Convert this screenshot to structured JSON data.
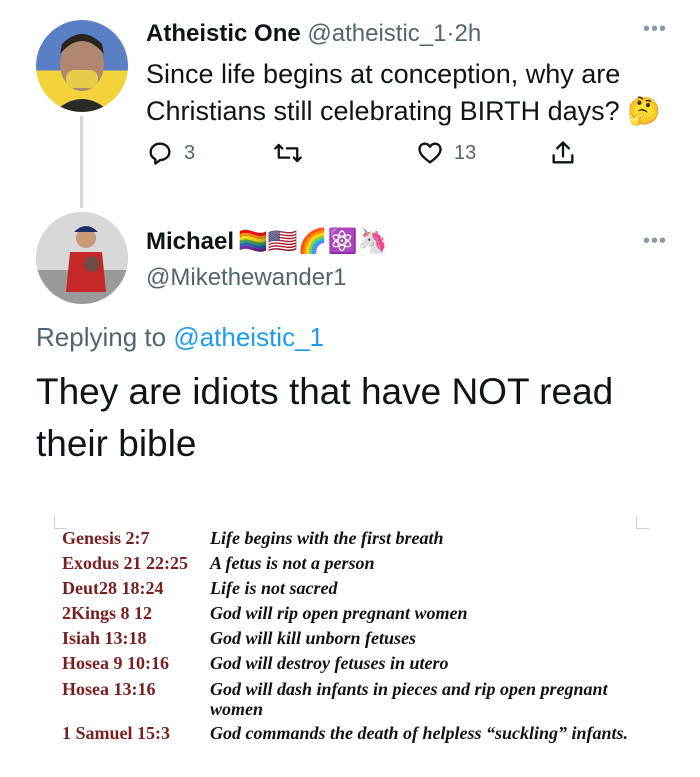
{
  "tweet1": {
    "name": "Atheistic One",
    "handle": "@atheistic_1",
    "separator": "·",
    "time": "2h",
    "text": "Since life begins at conception, why are Christians still celebrating BIRTH days? 🤔",
    "more": "•••",
    "actions": {
      "reply_count": "3",
      "retweet_count": "",
      "like_count": "13"
    }
  },
  "tweet2": {
    "name": "Michael",
    "emojis": "🏳️‍🌈🇺🇸🌈⚛️🦄",
    "handle": "@Mikethewander1",
    "more": "•••",
    "replying_prefix": "Replying to",
    "replying_to": "@atheistic_1",
    "text": "They are idiots that have NOT read their bible",
    "image": {
      "verses": [
        {
          "ref": "Genesis 2:7",
          "text": "Life begins with the first breath"
        },
        {
          "ref": "Exodus 21 22:25",
          "text": "A fetus is not a person"
        },
        {
          "ref": "Deut28 18:24",
          "text": "Life is not sacred"
        },
        {
          "ref": "2Kings 8 12",
          "text": "God will rip open pregnant women"
        },
        {
          "ref": "Isiah 13:18",
          "text": "God will kill unborn fetuses"
        },
        {
          "ref": "Hosea 9 10:16",
          "text": "God will destroy fetuses in utero"
        },
        {
          "ref": "Hosea 13:16",
          "text": "God will dash infants in pieces and rip open pregnant women"
        },
        {
          "ref": "1 Samuel 15:3",
          "text": "God commands the death of helpless “suckling” infants."
        }
      ]
    }
  },
  "colors": {
    "link": "#1d9bf0",
    "muted": "#536471",
    "verse_ref": "#7a1f1f"
  },
  "icons": [
    "reply-icon",
    "retweet-icon",
    "like-icon",
    "share-icon",
    "more-icon"
  ]
}
